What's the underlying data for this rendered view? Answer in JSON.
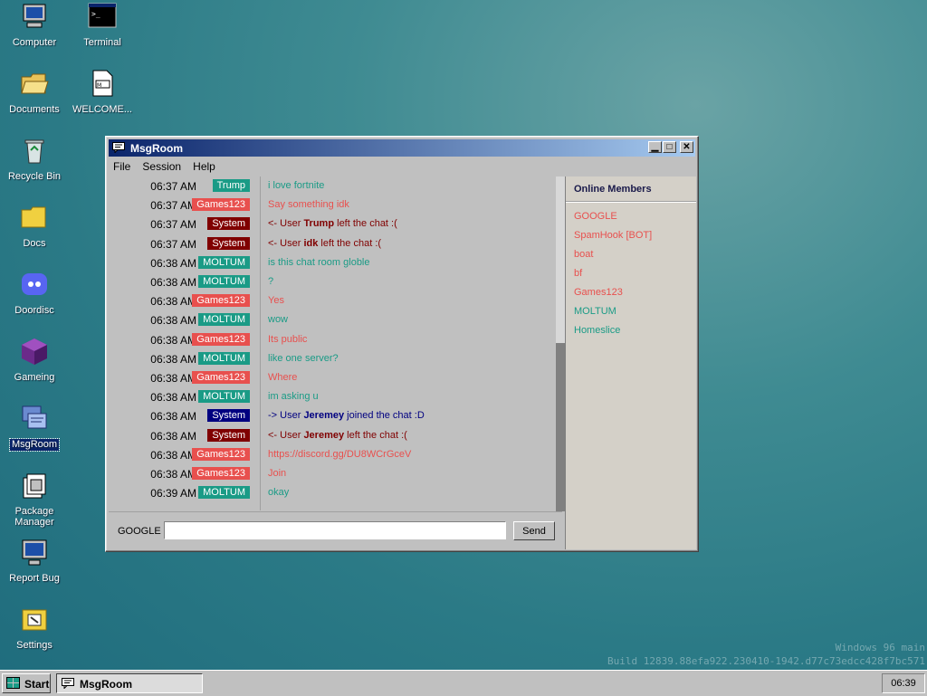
{
  "desktop": {
    "icons": [
      {
        "label": "Computer",
        "icon": "computer-icon"
      },
      {
        "label": "Terminal",
        "icon": "terminal-icon"
      },
      {
        "label": "Documents",
        "icon": "folder-open-icon"
      },
      {
        "label": "WELCOME...",
        "icon": "markdown-file-icon"
      },
      {
        "label": "Recycle Bin",
        "icon": "recycle-bin-icon"
      },
      {
        "label": "Docs",
        "icon": "folder-icon"
      },
      {
        "label": "Doordisc",
        "icon": "discord-icon"
      },
      {
        "label": "Gameing",
        "icon": "cube-icon"
      },
      {
        "label": "MsgRoom",
        "icon": "msgroom-icon"
      },
      {
        "label": "Package Manager",
        "icon": "package-icon"
      },
      {
        "label": "Report Bug",
        "icon": "bug-report-icon"
      },
      {
        "label": "Settings",
        "icon": "settings-icon"
      }
    ],
    "watermark_line1": "Windows 96 main",
    "watermark_line2": "Build 12839.88efa922.230410-1942.d77c73edcc428f7bc571"
  },
  "window": {
    "title": "MsgRoom",
    "menu": [
      "File",
      "Session",
      "Help"
    ],
    "messages": [
      {
        "time": "06:37 AM",
        "user": "Trump",
        "user_color": "#1a9b86",
        "msg_color": "#1a9b86",
        "text": "i love fortnite"
      },
      {
        "time": "06:37 AM",
        "user": "Games123",
        "user_color": "#e8504e",
        "msg_color": "#e8504e",
        "text": "Say something idk"
      },
      {
        "time": "06:37 AM",
        "user": "System",
        "user_color": "#800000",
        "msg_color": "#800000",
        "pre": "<- User ",
        "bold": "Trump",
        "post": " left the chat :("
      },
      {
        "time": "06:37 AM",
        "user": "System",
        "user_color": "#800000",
        "msg_color": "#800000",
        "pre": "<- User ",
        "bold": "idk",
        "post": " left the chat :("
      },
      {
        "time": "06:38 AM",
        "user": "MOLTUM",
        "user_color": "#1a9b86",
        "msg_color": "#1a9b86",
        "text": "is this chat room globle"
      },
      {
        "time": "06:38 AM",
        "user": "MOLTUM",
        "user_color": "#1a9b86",
        "msg_color": "#1a9b86",
        "text": "?"
      },
      {
        "time": "06:38 AM",
        "user": "Games123",
        "user_color": "#e8504e",
        "msg_color": "#e8504e",
        "text": "Yes"
      },
      {
        "time": "06:38 AM",
        "user": "MOLTUM",
        "user_color": "#1a9b86",
        "msg_color": "#1a9b86",
        "text": "wow"
      },
      {
        "time": "06:38 AM",
        "user": "Games123",
        "user_color": "#e8504e",
        "msg_color": "#e8504e",
        "text": "Its public"
      },
      {
        "time": "06:38 AM",
        "user": "MOLTUM",
        "user_color": "#1a9b86",
        "msg_color": "#1a9b86",
        "text": "like one server?"
      },
      {
        "time": "06:38 AM",
        "user": "Games123",
        "user_color": "#e8504e",
        "msg_color": "#e8504e",
        "text": "Where"
      },
      {
        "time": "06:38 AM",
        "user": "MOLTUM",
        "user_color": "#1a9b86",
        "msg_color": "#1a9b86",
        "text": "im asking u"
      },
      {
        "time": "06:38 AM",
        "user": "System",
        "user_color": "#000080",
        "msg_color": "#000080",
        "pre": "-> User ",
        "bold": "Jeremey",
        "post": " joined the chat :D"
      },
      {
        "time": "06:38 AM",
        "user": "System",
        "user_color": "#800000",
        "msg_color": "#800000",
        "pre": "<- User ",
        "bold": "Jeremey",
        "post": " left the chat :("
      },
      {
        "time": "06:38 AM",
        "user": "Games123",
        "user_color": "#e8504e",
        "msg_color": "#e8504e",
        "text": "https://discord.gg/DU8WCrGceV"
      },
      {
        "time": "06:38 AM",
        "user": "Games123",
        "user_color": "#e8504e",
        "msg_color": "#e8504e",
        "text": "Join"
      },
      {
        "time": "06:39 AM",
        "user": "MOLTUM",
        "user_color": "#1a9b86",
        "msg_color": "#1a9b86",
        "text": "okay"
      }
    ],
    "members_title": "Online Members",
    "members": [
      {
        "name": "GOOGLE",
        "color": "#e8504e"
      },
      {
        "name": "SpamHook [BOT]",
        "color": "#e8504e"
      },
      {
        "name": "boat",
        "color": "#e8504e"
      },
      {
        "name": "bf",
        "color": "#e8504e"
      },
      {
        "name": "Games123",
        "color": "#e8504e"
      },
      {
        "name": "MOLTUM",
        "color": "#1a9b86"
      },
      {
        "name": "Homeslice",
        "color": "#1a9b86"
      }
    ],
    "input": {
      "username": "GOOGLE",
      "value": "",
      "send_label": "Send"
    }
  },
  "taskbar": {
    "start_label": "Start",
    "task_label": "MsgRoom",
    "clock": "06:39"
  }
}
